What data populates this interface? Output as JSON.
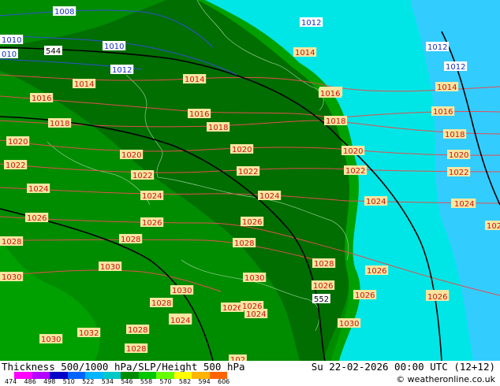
{
  "footer": {
    "title": "Thickness 500/1000 hPa/SLP/Height 500 hPa",
    "date": "Su 22-02-2026 00:00 UTC (12+12)",
    "copyright": "© weatheronline.co.uk"
  },
  "scale": {
    "ticks": [
      "474",
      "486",
      "498",
      "510",
      "522",
      "534",
      "546",
      "558",
      "570",
      "582",
      "594",
      "606"
    ],
    "colors": [
      "#ff00ff",
      "#b400ff",
      "#0000c8",
      "#0064ff",
      "#00b4ff",
      "#00c8c8",
      "#008c00",
      "#00c800",
      "#66ff00",
      "#ffff00",
      "#ffb400",
      "#ff6400"
    ]
  },
  "colors": {
    "zone_deep_green": "#006e00",
    "zone_mid_green": "#008c00",
    "zone_light_green": "#00a000",
    "zone_cyan": "#00e6e6",
    "zone_light_cyan": "#00ffff",
    "zone_sky": "#33ccff",
    "isobar": "#e05050",
    "thickness_line": "#000000",
    "height_line": "#3050d0",
    "label_bg": "#f5e6a0"
  },
  "isobar_labels": [
    {
      "text": "1008",
      "cyan": true
    },
    {
      "text": "1012",
      "cyan": true
    },
    {
      "text": "1010",
      "cyan": true
    },
    {
      "text": "1012",
      "cyan": true
    },
    {
      "text": "1010",
      "cyan": true
    },
    {
      "text": "010",
      "cyan": true
    },
    {
      "text": "1012",
      "cyan": true
    },
    {
      "text": "1012",
      "cyan": true
    },
    {
      "text": "1014"
    },
    {
      "text": "1014"
    },
    {
      "text": "1014"
    },
    {
      "text": "1014"
    },
    {
      "text": "1014"
    },
    {
      "text": "1016"
    },
    {
      "text": "1016"
    },
    {
      "text": "1016"
    },
    {
      "text": "1016"
    },
    {
      "text": "1018"
    },
    {
      "text": "1018"
    },
    {
      "text": "1018"
    },
    {
      "text": "1018"
    },
    {
      "text": "1020"
    },
    {
      "text": "1020"
    },
    {
      "text": "1020"
    },
    {
      "text": "1020"
    },
    {
      "text": "1020"
    },
    {
      "text": "1022"
    },
    {
      "text": "1022"
    },
    {
      "text": "1022"
    },
    {
      "text": "1022"
    },
    {
      "text": "1022"
    },
    {
      "text": "1024"
    },
    {
      "text": "1024"
    },
    {
      "text": "1024"
    },
    {
      "text": "1024"
    },
    {
      "text": "1024"
    },
    {
      "text": "1026"
    },
    {
      "text": "1026"
    },
    {
      "text": "1026"
    },
    {
      "text": "1026"
    },
    {
      "text": "1028"
    },
    {
      "text": "1028"
    },
    {
      "text": "1028"
    },
    {
      "text": "1030"
    },
    {
      "text": "1030"
    },
    {
      "text": "1030"
    },
    {
      "text": "1026"
    },
    {
      "text": "1026"
    },
    {
      "text": "1026"
    },
    {
      "text": "1028"
    },
    {
      "text": "1028"
    },
    {
      "text": "1024"
    },
    {
      "text": "1024"
    },
    {
      "text": "1030"
    },
    {
      "text": "1032"
    },
    {
      "text": "1030"
    },
    {
      "text": "1028"
    },
    {
      "text": "1026"
    },
    {
      "text": "1026"
    },
    {
      "text": "1028"
    },
    {
      "text": "1030"
    },
    {
      "text": "1024"
    },
    {
      "text": "1024"
    },
    {
      "text": "1026"
    },
    {
      "text": "1026"
    },
    {
      "text": "102"
    },
    {
      "text": "1024"
    }
  ],
  "height_labels": [
    {
      "text": "544"
    },
    {
      "text": "552"
    }
  ]
}
